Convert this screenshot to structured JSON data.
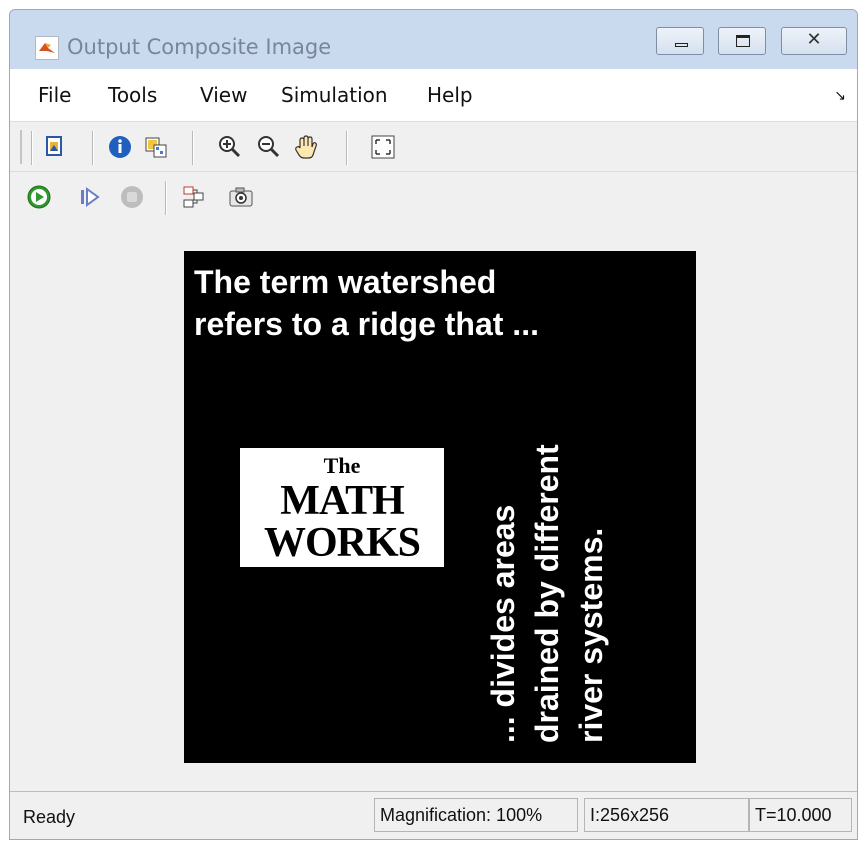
{
  "window": {
    "title": "Output Composite Image",
    "close_glyph": "✕"
  },
  "menu": {
    "items": [
      "File",
      "Tools",
      "View",
      "Simulation",
      "Help"
    ],
    "overflow_glyph": "↘"
  },
  "toolbar": {
    "row1_icons": [
      "print-to-figure-icon",
      "info-icon",
      "export-to-workspace-icon",
      "zoom-in-icon",
      "zoom-out-icon",
      "pan-hand-icon",
      "fit-to-view-icon"
    ],
    "row2_icons": [
      "run-icon",
      "step-forward-icon",
      "stop-icon",
      "highlight-block-icon",
      "snapshot-camera-icon"
    ]
  },
  "image": {
    "headline_line1": "The term watershed",
    "headline_line2": "refers to a ridge that ...",
    "logo_the": "The",
    "logo_math": "MATH",
    "logo_works": "WORKS",
    "vertical_line1": "... divides areas",
    "vertical_line2": "drained by different",
    "vertical_line3": "river systems."
  },
  "status": {
    "ready": "Ready",
    "magnification": "Magnification: 100%",
    "image_size": "I:256x256",
    "time": "T=10.000"
  },
  "colors": {
    "title_bar": "#c9daef",
    "toolbar_bg": "#f0f0f0",
    "image_bg": "#000000",
    "run_green": "#2e9a2e"
  }
}
